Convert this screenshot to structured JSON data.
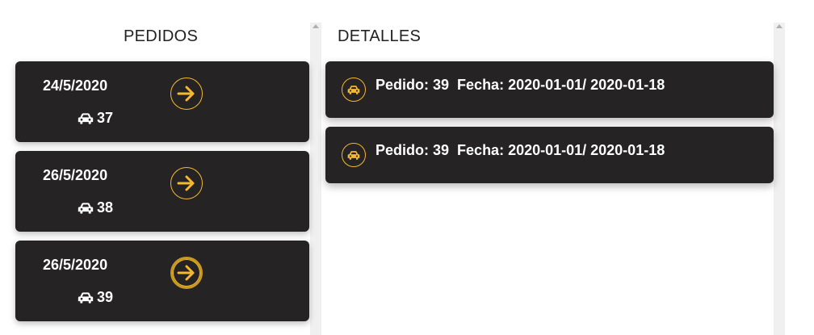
{
  "left_panel": {
    "title": "PEDIDOS",
    "orders": [
      {
        "date": "24/5/2020",
        "number": "37"
      },
      {
        "date": "26/5/2020",
        "number": "38"
      },
      {
        "date": "26/5/2020",
        "number": "39"
      }
    ]
  },
  "right_panel": {
    "title": "DETALLES",
    "details": [
      {
        "pedido_label": "Pedido: 39",
        "fecha_label": "Fecha: 2020-01-01/ 2020-01-18"
      },
      {
        "pedido_label": "Pedido: 39",
        "fecha_label": "Fecha: 2020-01-01/ 2020-01-18"
      }
    ]
  },
  "icons": {
    "car": "car-icon",
    "arrow": "arrow-right-circle-icon"
  },
  "colors": {
    "card_bg": "#252323",
    "accent": "#f5b82e",
    "text": "#ffffff"
  }
}
